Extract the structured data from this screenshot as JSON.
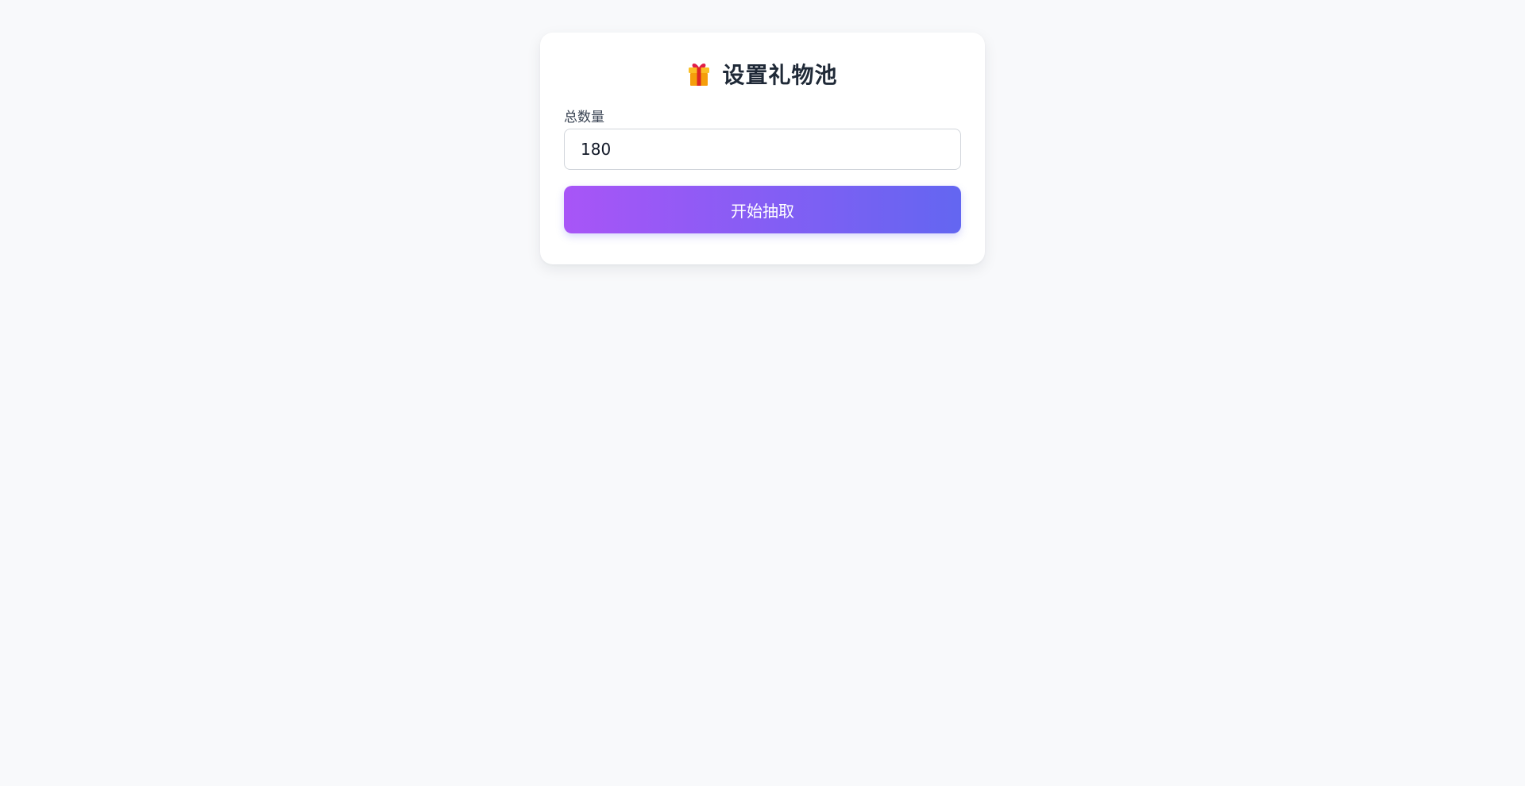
{
  "card": {
    "title": "设置礼物池",
    "title_icon": "gift-icon",
    "total_label": "总数量",
    "total_value": "180",
    "start_button_label": "开始抽取"
  },
  "colors": {
    "background": "#f8f9fb",
    "card": "#ffffff",
    "title_text": "#1f2937",
    "button_gradient_start": "#a855f7",
    "button_gradient_end": "#6366f1",
    "button_text": "#ffffff"
  }
}
